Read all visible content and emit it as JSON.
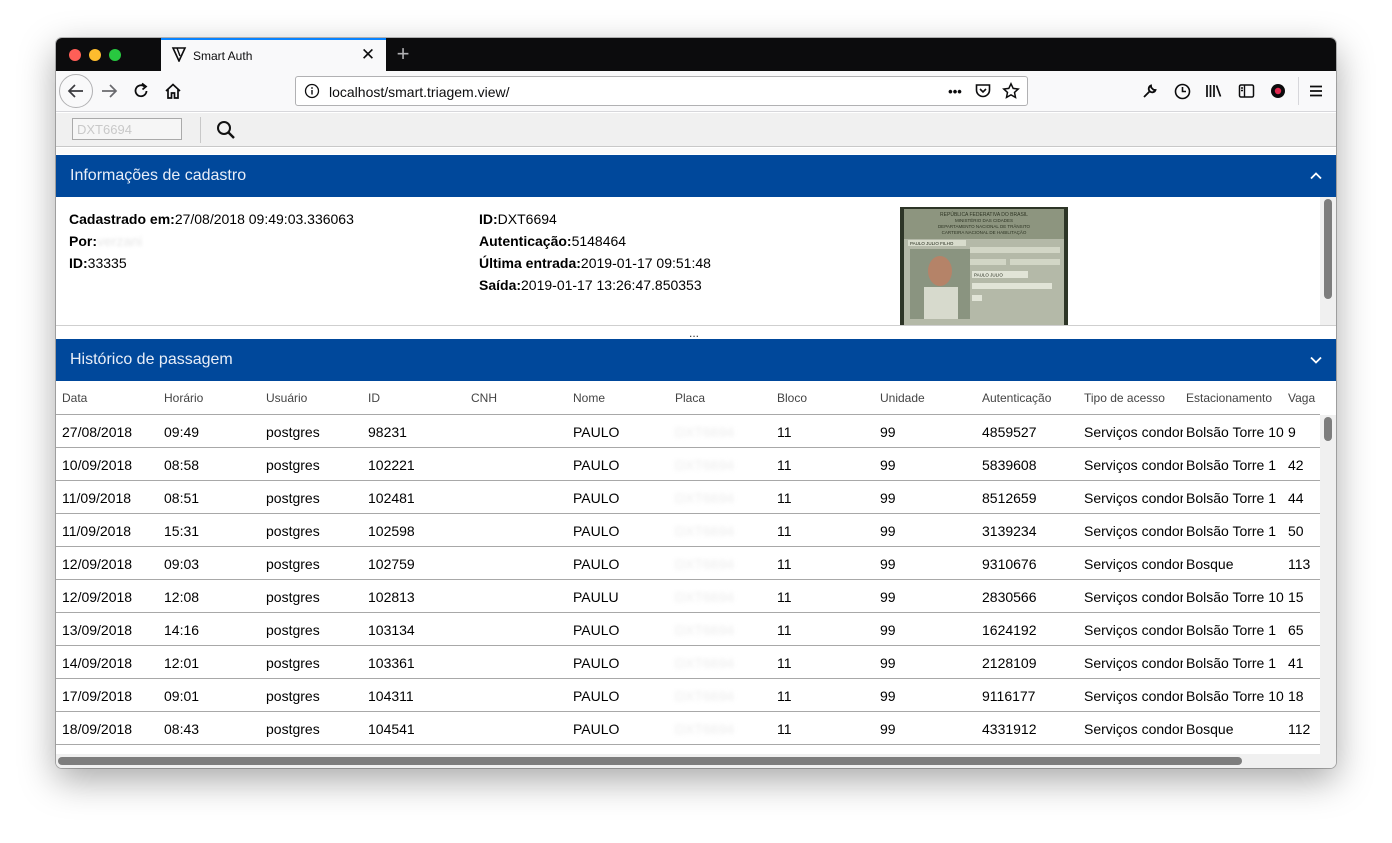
{
  "browser": {
    "tab_title": "Smart Auth",
    "tab_close": "✕",
    "new_tab": "+",
    "url": "localhost/smart.triagem.view/",
    "url_more": "•••"
  },
  "app_toolbar": {
    "plate_value": "DXT6694"
  },
  "info_panel": {
    "title": "Informações de cadastro",
    "col1": [
      {
        "label": "Cadastrado em:",
        "value": "27/08/2018 09:49:03.336063"
      },
      {
        "label": "Por:",
        "value": "verzani"
      },
      {
        "label": "ID:",
        "value": "33335"
      }
    ],
    "col2": [
      {
        "label": "ID:",
        "value": "DXT6694"
      },
      {
        "label": "Autenticação:",
        "value": "5148464"
      },
      {
        "label": "Última entrada:",
        "value": "2019-01-17 09:51:48"
      },
      {
        "label": "Saída:",
        "value": "2019-01-17 13:26:47.850353"
      }
    ],
    "photo_text": [
      "REPÚBLICA FEDERATIVA DO BRASIL",
      "MINISTÉRIO DAS CIDADES",
      "DEPARTAMENTO NACIONAL DE TRÂNSITO",
      "CARTEIRA NACIONAL DE HABILITAÇÃO",
      "PAULO JULIO FILHO",
      "PAULO JULIO"
    ]
  },
  "splitter_label": "...",
  "history_panel": {
    "title": "Histórico de passagem",
    "columns": [
      "Data",
      "Horário",
      "Usuário",
      "ID",
      "CNH",
      "Nome",
      "Placa",
      "Bloco",
      "Unidade",
      "Autenticação",
      "Tipo de acesso",
      "Estacionamento",
      "Vaga"
    ],
    "rows": [
      [
        "27/08/2018",
        "09:49",
        "postgres",
        "98231",
        "",
        "PAULO",
        "DXT6694",
        "11",
        "99",
        "4859527",
        "Serviços condomínio",
        "Bolsão Torre 10",
        "9"
      ],
      [
        "10/09/2018",
        "08:58",
        "postgres",
        "102221",
        "",
        "PAULO",
        "DXT6694",
        "11",
        "99",
        "5839608",
        "Serviços condomínio",
        "Bolsão Torre 1",
        "42"
      ],
      [
        "11/09/2018",
        "08:51",
        "postgres",
        "102481",
        "",
        "PAULO",
        "DXT6694",
        "11",
        "99",
        "8512659",
        "Serviços condomínio",
        "Bolsão Torre 1",
        "44"
      ],
      [
        "11/09/2018",
        "15:31",
        "postgres",
        "102598",
        "",
        "PAULO",
        "DXT6694",
        "11",
        "99",
        "3139234",
        "Serviços condomínio",
        "Bolsão Torre 1",
        "50"
      ],
      [
        "12/09/2018",
        "09:03",
        "postgres",
        "102759",
        "",
        "PAULO",
        "DXT6694",
        "11",
        "99",
        "9310676",
        "Serviços condomínio",
        "Bosque",
        "113"
      ],
      [
        "12/09/2018",
        "12:08",
        "postgres",
        "102813",
        "",
        "PAULU",
        "DXT6694",
        "11",
        "99",
        "2830566",
        "Serviços condomínio",
        "Bolsão Torre 10",
        "15"
      ],
      [
        "13/09/2018",
        "14:16",
        "postgres",
        "103134",
        "",
        "PAULO",
        "DXT6694",
        "11",
        "99",
        "1624192",
        "Serviços condomínio",
        "Bolsão Torre 1",
        "65"
      ],
      [
        "14/09/2018",
        "12:01",
        "postgres",
        "103361",
        "",
        "PAULO",
        "DXT6694",
        "11",
        "99",
        "2128109",
        "Serviços condomínio",
        "Bolsão Torre 1",
        "41"
      ],
      [
        "17/09/2018",
        "09:01",
        "postgres",
        "104311",
        "",
        "PAULO",
        "DXT6694",
        "11",
        "99",
        "9116177",
        "Serviços condomínio",
        "Bolsão Torre 10",
        "18"
      ],
      [
        "18/09/2018",
        "08:43",
        "postgres",
        "104541",
        "",
        "PAULO",
        "DXT6694",
        "11",
        "99",
        "4331912",
        "Serviços condomínio",
        "Bosque",
        "112"
      ]
    ]
  },
  "colors": {
    "panel_header": "#00489b",
    "tab_accent": "#0a84ff"
  }
}
